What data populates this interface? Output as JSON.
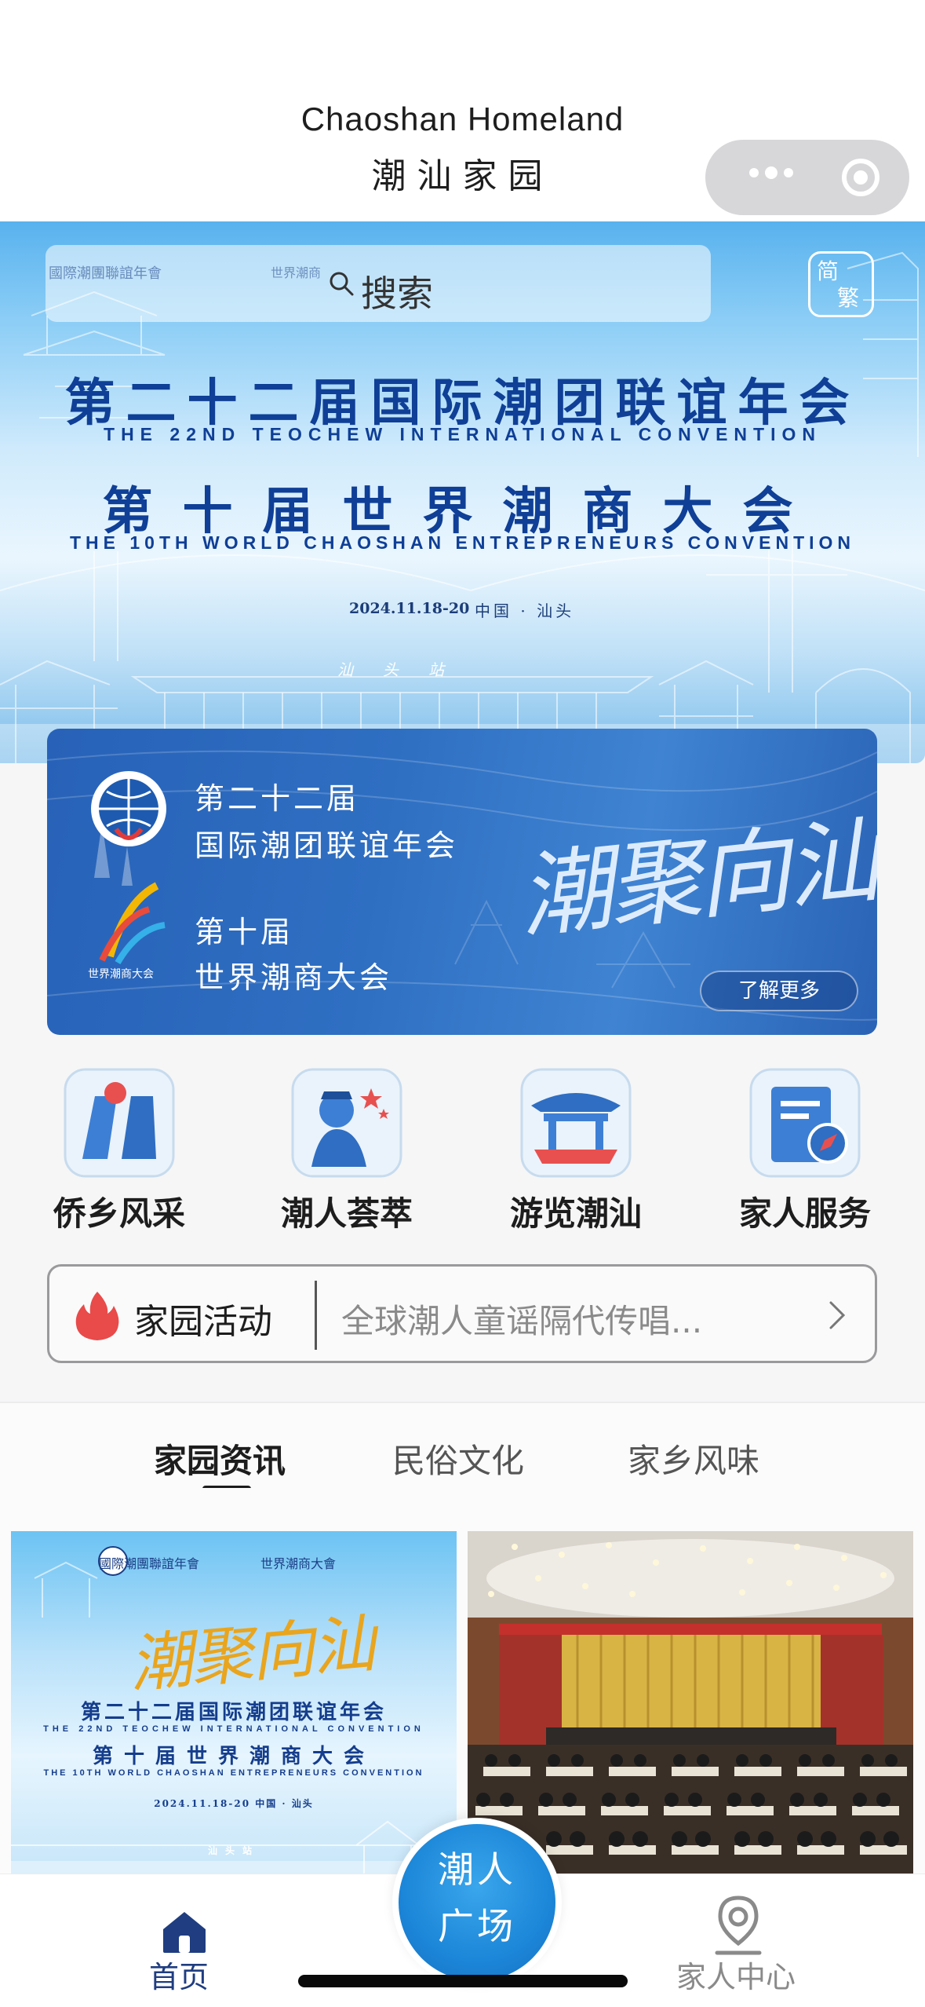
{
  "header": {
    "title_en": "Chaoshan Homeland",
    "title_zh": "潮汕家园",
    "more_icon": "more-dots-icon",
    "close_icon": "target-close-icon"
  },
  "banner": {
    "search_placeholder": "搜索",
    "org_logo_1": "國際潮團聯誼年會",
    "org_logo_2": "世界潮商",
    "lang_toggle": {
      "top": "简",
      "bottom": "繁"
    },
    "convention_zh_1": "第二十二届国际潮团联谊年会",
    "convention_en_1": "THE 22ND TEOCHEW INTERNATIONAL CONVENTION",
    "convention_zh_2": "第十届世界潮商大会",
    "convention_en_2": "THE 10TH WORLD CHAOSHAN ENTREPRENEURS CONVENTION",
    "date": "2024.11.18-20",
    "location": "中国 · 汕头",
    "station": "汕头站"
  },
  "promo": {
    "line1": "第二十二届",
    "line2": "国际潮团联谊年会",
    "line3": "第十届",
    "line4": "世界潮商大会",
    "logo_caption": "世界潮商大会",
    "calligraphy": "潮聚向汕",
    "learn_more": "了解更多"
  },
  "nav": [
    {
      "label": "侨乡风采",
      "icon": "overseas-gate-icon"
    },
    {
      "label": "潮人荟萃",
      "icon": "people-star-icon"
    },
    {
      "label": "游览潮汕",
      "icon": "pavilion-icon"
    },
    {
      "label": "家人服务",
      "icon": "service-compass-icon"
    }
  ],
  "activity": {
    "label": "家园活动",
    "text": "全球潮人童谣隔代传唱...",
    "icon": "flame-icon"
  },
  "tabs": [
    {
      "label": "家园资讯",
      "active": true
    },
    {
      "label": "民俗文化",
      "active": false
    },
    {
      "label": "家乡风味",
      "active": false
    }
  ],
  "news_card_1": {
    "org1": "國際潮團聯誼年會",
    "org2": "世界潮商大會",
    "calligraphy": "潮聚向汕",
    "zh1": "第二十二届国际潮团联谊年会",
    "en1": "THE 22ND TEOCHEW INTERNATIONAL CONVENTION",
    "zh2": "第十届世界潮商大会",
    "en2": "THE 10TH WORLD CHAOSHAN ENTREPRENEURS CONVENTION",
    "date": "2024.11.18-20   中国 · 汕头",
    "station": "汕头站"
  },
  "tabbar": {
    "home": "首页",
    "center_line1": "潮人",
    "center_line2": "广场",
    "me": "家人中心"
  },
  "colors": {
    "primary_blue": "#0f3f96",
    "accent_blue": "#1c86d8",
    "flame_red": "#e94a4a"
  }
}
